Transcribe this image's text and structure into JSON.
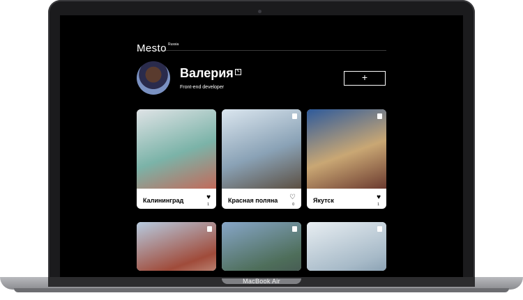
{
  "device": {
    "label": "MacBook Air"
  },
  "header": {
    "logo": "Mesto",
    "logo_sup": "Russia"
  },
  "profile": {
    "name": "Валерия",
    "job": "Front-end developer",
    "edit_icon": "pencil-icon",
    "add_label": "+"
  },
  "cards": [
    {
      "title": "Калининград",
      "likes": "1",
      "liked": true,
      "colors": [
        "#dfe3e6",
        "#7bb3a8",
        "#c26a5a"
      ]
    },
    {
      "title": "Красная поляна",
      "likes": "0",
      "liked": false,
      "colors": [
        "#dbe6ef",
        "#8aa2b6",
        "#5b4f42"
      ]
    },
    {
      "title": "Якутск",
      "likes": "1",
      "liked": true,
      "colors": [
        "#2e5a9b",
        "#c9a774",
        "#6b3a2f"
      ]
    },
    {
      "title": "",
      "likes": "",
      "liked": false,
      "colors": [
        "#b7cbe0",
        "#a04b3a",
        "#e2d7c9"
      ]
    },
    {
      "title": "",
      "likes": "",
      "liked": false,
      "colors": [
        "#87a6c8",
        "#4e6e5a",
        "#3c3f4a"
      ]
    },
    {
      "title": "",
      "likes": "",
      "liked": false,
      "colors": [
        "#e8eef2",
        "#a7bac8",
        "#5e7a92"
      ]
    }
  ]
}
